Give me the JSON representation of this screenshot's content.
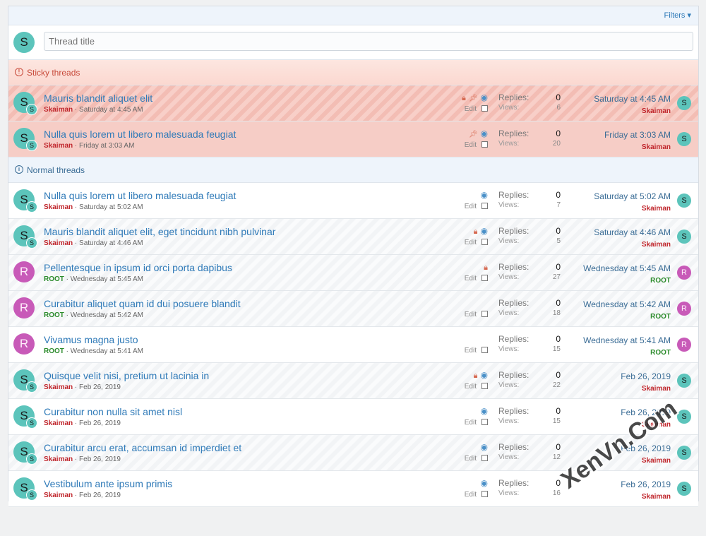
{
  "toolbar": {
    "filters_label": "Filters ▾"
  },
  "new_thread": {
    "avatar_letter": "S",
    "placeholder": "Thread title"
  },
  "sections": {
    "sticky": {
      "label": "Sticky threads",
      "icon": "exclamation-icon"
    },
    "normal": {
      "label": "Normal threads",
      "icon": "info-icon"
    }
  },
  "sticky_threads": [
    {
      "title": "Mauris blandit aliquet elit",
      "author": "Skaiman",
      "date": "Saturday at 4:45 AM",
      "letter": "S",
      "locked": true,
      "pinned": true,
      "watched": true,
      "edit": "Edit",
      "replies_label": "Replies:",
      "views_label": "Views:",
      "replies": "0",
      "views": "6",
      "last_date": "Saturday at 4:45 AM",
      "last_user": "Skaiman",
      "last_letter": "S"
    },
    {
      "title": "Nulla quis lorem ut libero malesuada feugiat",
      "author": "Skaiman",
      "date": "Friday at 3:03 AM",
      "letter": "S",
      "locked": false,
      "pinned": true,
      "watched": true,
      "edit": "Edit",
      "replies_label": "Replies:",
      "views_label": "Views:",
      "replies": "0",
      "views": "20",
      "last_date": "Friday at 3:03 AM",
      "last_user": "Skaiman",
      "last_letter": "S"
    }
  ],
  "threads": [
    {
      "title": "Nulla quis lorem ut libero malesuada feugiat",
      "author": "Skaiman",
      "date": "Saturday at 5:02 AM",
      "letter": "S",
      "locked": false,
      "watched": true,
      "edit": "Edit",
      "replies_label": "Replies:",
      "views_label": "Views:",
      "replies": "0",
      "views": "7",
      "last_date": "Saturday at 5:02 AM",
      "last_user": "Skaiman",
      "last_letter": "S"
    },
    {
      "title": "Mauris blandit aliquet elit, eget tincidunt nibh pulvinar",
      "author": "Skaiman",
      "date": "Saturday at 4:46 AM",
      "letter": "S",
      "locked": true,
      "watched": true,
      "edit": "Edit",
      "replies_label": "Replies:",
      "views_label": "Views:",
      "replies": "0",
      "views": "5",
      "last_date": "Saturday at 4:46 AM",
      "last_user": "Skaiman",
      "last_letter": "S"
    },
    {
      "title": "Pellentesque in ipsum id orci porta dapibus",
      "author": "ROOT",
      "date": "Wednesday at 5:45 AM",
      "letter": "R",
      "locked": true,
      "watched": false,
      "edit": "Edit",
      "replies_label": "Replies:",
      "views_label": "Views:",
      "replies": "0",
      "views": "27",
      "last_date": "Wednesday at 5:45 AM",
      "last_user": "ROOT",
      "last_letter": "R"
    },
    {
      "title": "Curabitur aliquet quam id dui posuere blandit",
      "author": "ROOT",
      "date": "Wednesday at 5:42 AM",
      "letter": "R",
      "locked": false,
      "watched": false,
      "edit": "Edit",
      "replies_label": "Replies:",
      "views_label": "Views:",
      "replies": "0",
      "views": "18",
      "last_date": "Wednesday at 5:42 AM",
      "last_user": "ROOT",
      "last_letter": "R"
    },
    {
      "title": "Vivamus magna justo",
      "author": "ROOT",
      "date": "Wednesday at 5:41 AM",
      "letter": "R",
      "locked": false,
      "watched": false,
      "edit": "Edit",
      "replies_label": "Replies:",
      "views_label": "Views:",
      "replies": "0",
      "views": "15",
      "last_date": "Wednesday at 5:41 AM",
      "last_user": "ROOT",
      "last_letter": "R"
    },
    {
      "title": "Quisque velit nisi, pretium ut lacinia in",
      "author": "Skaiman",
      "date": "Feb 26, 2019",
      "letter": "S",
      "locked": true,
      "watched": true,
      "edit": "Edit",
      "replies_label": "Replies:",
      "views_label": "Views:",
      "replies": "0",
      "views": "22",
      "last_date": "Feb 26, 2019",
      "last_user": "Skaiman",
      "last_letter": "S"
    },
    {
      "title": "Curabitur non nulla sit amet nisl",
      "author": "Skaiman",
      "date": "Feb 26, 2019",
      "letter": "S",
      "locked": false,
      "watched": true,
      "edit": "Edit",
      "replies_label": "Replies:",
      "views_label": "Views:",
      "replies": "0",
      "views": "15",
      "last_date": "Feb 26, 2019",
      "last_user": "Skaiman",
      "last_letter": "S"
    },
    {
      "title": "Curabitur arcu erat, accumsan id imperdiet et",
      "author": "Skaiman",
      "date": "Feb 26, 2019",
      "letter": "S",
      "locked": false,
      "watched": true,
      "edit": "Edit",
      "replies_label": "Replies:",
      "views_label": "Views:",
      "replies": "0",
      "views": "12",
      "last_date": "Feb 26, 2019",
      "last_user": "Skaiman",
      "last_letter": "S"
    },
    {
      "title": "Vestibulum ante ipsum primis",
      "author": "Skaiman",
      "date": "Feb 26, 2019",
      "letter": "S",
      "locked": false,
      "watched": true,
      "edit": "Edit",
      "replies_label": "Replies:",
      "views_label": "Views:",
      "replies": "0",
      "views": "16",
      "last_date": "Feb 26, 2019",
      "last_user": "Skaiman",
      "last_letter": "S"
    }
  ],
  "watermark": "XenVn.Com",
  "colors": {
    "link": "#2f7ab8",
    "sticky_bg": "#f6cdc6",
    "author_red": "#c0262c",
    "author_green": "#2b8b2b",
    "avatar_s": "#5cc4bb",
    "avatar_r": "#c85ab8"
  }
}
